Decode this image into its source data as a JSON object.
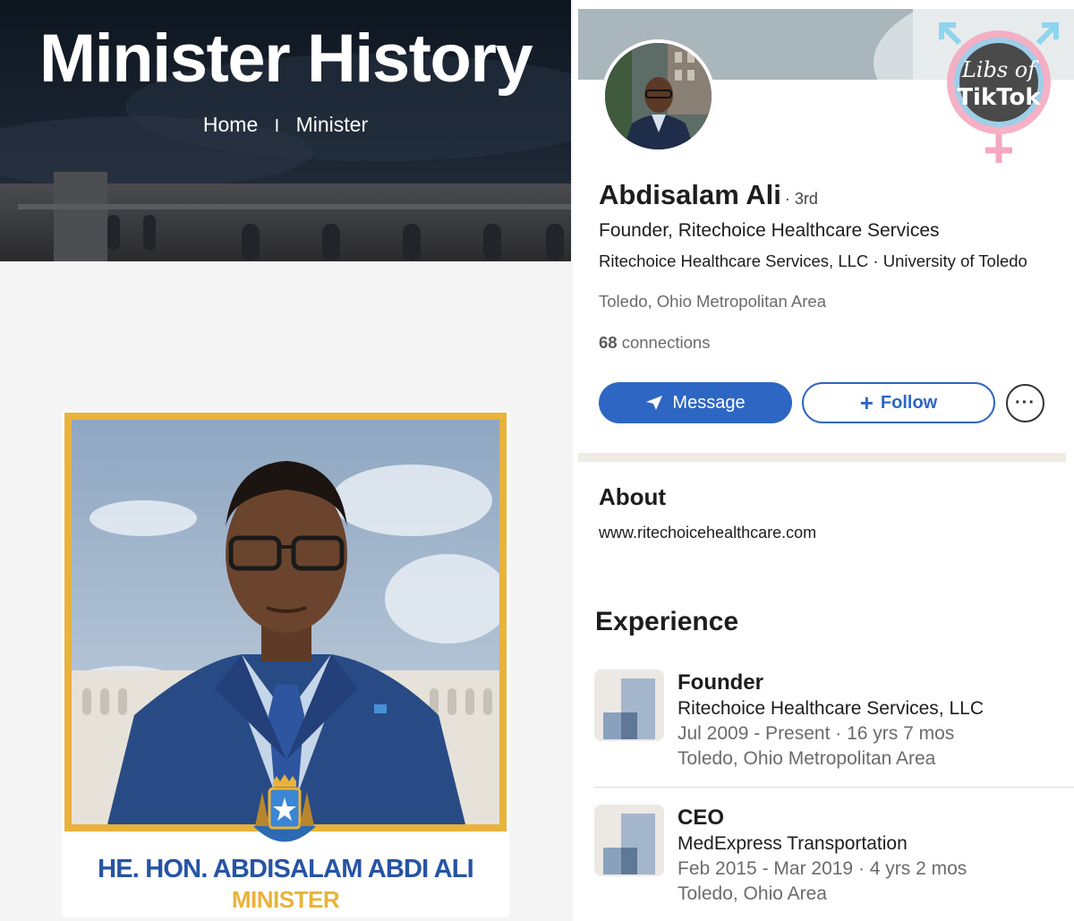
{
  "left": {
    "hero_title": "Minister History",
    "breadcrumb": {
      "home": "Home",
      "separator": "I",
      "current": "Minister"
    },
    "card": {
      "name": "HE. HON. ABDISALAM ABDI ALI",
      "role": "MINISTER"
    },
    "colors": {
      "accent_gold": "#e9b33b",
      "name_blue": "#2653a3"
    }
  },
  "right": {
    "watermark": {
      "line1": "Libs of",
      "line2": "TikTok"
    },
    "profile": {
      "name": "Abdisalam Ali",
      "degree": "· 3rd",
      "headline": "Founder, Ritechoice Healthcare Services",
      "company_line": "Ritechoice Healthcare Services, LLC · University of Toledo",
      "location": "Toledo, Ohio Metropolitan Area",
      "connections_count": "68",
      "connections_label": "connections"
    },
    "buttons": {
      "message": "Message",
      "follow": "Follow",
      "more": "···"
    },
    "about": {
      "title": "About",
      "url": "www.ritechoicehealthcare.com"
    },
    "experience": {
      "title": "Experience",
      "items": [
        {
          "role": "Founder",
          "company": "Ritechoice Healthcare Services, LLC",
          "dates": "Jul 2009 - Present · 16 yrs 7 mos",
          "location": "Toledo, Ohio Metropolitan Area"
        },
        {
          "role": "CEO",
          "company": "MedExpress Transportation",
          "dates": "Feb 2015 - Mar 2019 · 4 yrs 2 mos",
          "location": "Toledo, Ohio Area"
        }
      ]
    },
    "colors": {
      "primary_blue": "#2e66c4"
    }
  }
}
